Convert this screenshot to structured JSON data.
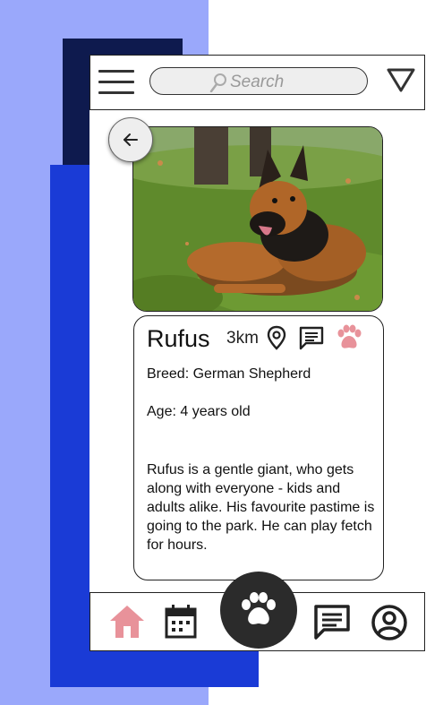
{
  "header": {
    "search_placeholder": "Search",
    "menu_icon": "hamburger-menu-icon",
    "filter_icon": "triangle-filter-icon"
  },
  "profile": {
    "photo_alt": "German Shepherd dog lying on grass",
    "name": "Rufus",
    "distance": "3km",
    "breed": "Breed: German Shepherd",
    "age": "Age: 4 years old",
    "description": "Rufus is a gentle giant, who gets along with everyone - kids and adults alike. His favourite pastime is going to the park. He can play fetch for hours."
  },
  "nav": {
    "items": [
      "home-icon",
      "calendar-icon",
      "paw-icon",
      "chat-icon",
      "profile-icon"
    ],
    "active": "home"
  },
  "colors": {
    "accent_pink": "#e8929a",
    "background_light": "#9aa8fb",
    "background_navy": "#0e1a4e",
    "background_blue": "#1a3bd6",
    "fab": "#2b2b2b"
  }
}
